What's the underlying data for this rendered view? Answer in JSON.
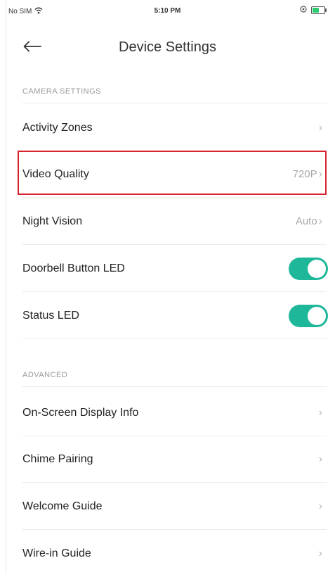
{
  "status_bar": {
    "carrier": "No SIM",
    "time": "5:10 PM"
  },
  "header": {
    "title": "Device Settings"
  },
  "camera_section": {
    "title": "CAMERA SETTINGS",
    "rows": [
      {
        "label": "Activity Zones",
        "value": ""
      },
      {
        "label": "Video Quality",
        "value": "720P"
      },
      {
        "label": "Night Vision",
        "value": "Auto"
      },
      {
        "label": "Doorbell Button LED",
        "toggle_on": true
      },
      {
        "label": "Status LED",
        "toggle_on": true
      }
    ]
  },
  "advanced_section": {
    "title": "ADVANCED",
    "rows": [
      {
        "label": "On-Screen Display Info"
      },
      {
        "label": "Chime Pairing"
      },
      {
        "label": "Welcome Guide"
      },
      {
        "label": "Wire-in Guide"
      }
    ]
  },
  "colors": {
    "accent": "#1fb79a",
    "highlight": "#d9232e"
  },
  "icons": {
    "back": "arrow-left-icon",
    "chevron": "chevron-right-icon",
    "wifi": "wifi-icon",
    "battery": "battery-icon"
  }
}
